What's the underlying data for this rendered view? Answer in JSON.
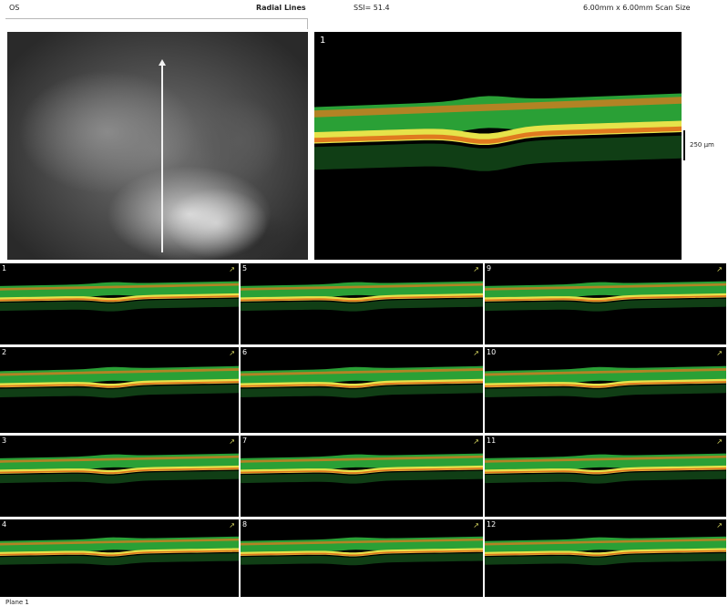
{
  "header": {
    "eye": "OS",
    "scan_pattern": "Radial Lines",
    "ssi": "SSI= 51.4",
    "scan_size": "6.00mm x 6.00mm Scan Size"
  },
  "main_scan": {
    "label": "1",
    "scale_label": "250 µm"
  },
  "scans": [
    {
      "label": "1"
    },
    {
      "label": "2"
    },
    {
      "label": "3"
    },
    {
      "label": "4"
    },
    {
      "label": "5"
    },
    {
      "label": "6"
    },
    {
      "label": "7"
    },
    {
      "label": "8"
    },
    {
      "label": "9"
    },
    {
      "label": "10"
    },
    {
      "label": "11"
    },
    {
      "label": "12"
    }
  ],
  "footer": {
    "text": "Plane 1"
  },
  "colors": {
    "scan_background": "#000000",
    "retina_green": "#2fb13c",
    "retina_yellow": "#e6e34a",
    "retina_orange": "#e07a1f",
    "marker_arrow": "#d8d860"
  },
  "icons": {
    "scan_orientation": "arrow-up-right-icon",
    "fundus_scan_line": "arrow-up-icon"
  }
}
